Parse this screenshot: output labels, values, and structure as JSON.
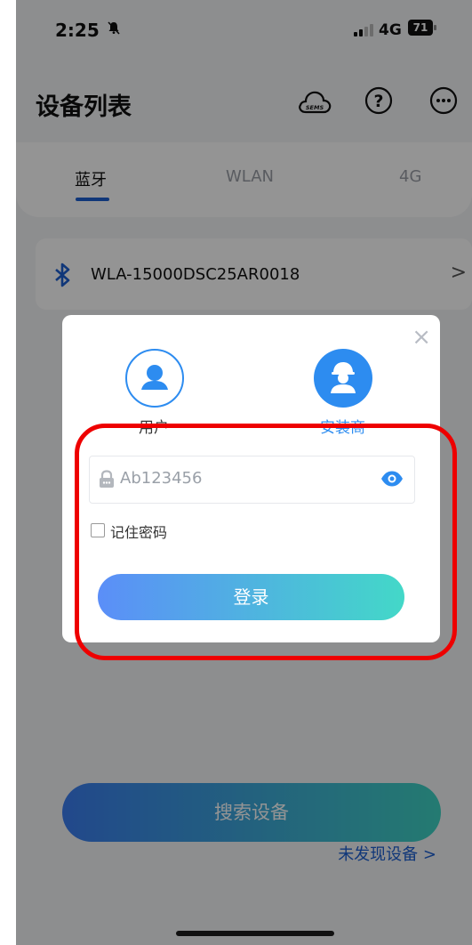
{
  "status_bar": {
    "time": "2:25",
    "network": "4G",
    "battery": "71"
  },
  "header": {
    "title": "设备列表",
    "cloud_badge": "SEMS",
    "help_glyph": "?"
  },
  "tabs": [
    {
      "label": "蓝牙",
      "active": true
    },
    {
      "label": "WLAN",
      "active": false
    },
    {
      "label": "4G",
      "active": false
    }
  ],
  "device": {
    "name": "WLA-15000DSC25AR0018",
    "arrow": ">"
  },
  "search_button": {
    "label": "搜索设备"
  },
  "not_found_link": {
    "label": "未发现设备 >"
  },
  "login_dialog": {
    "close_glyph": "×",
    "roles": [
      {
        "label": "用户",
        "selected": false
      },
      {
        "label": "安装商",
        "selected": true
      }
    ],
    "password": {
      "value": "Ab123456"
    },
    "remember": {
      "label": "记住密码",
      "checked": false
    },
    "login_button": {
      "label": "登录"
    }
  },
  "colors": {
    "accent": "#2d8cf0",
    "link": "#1d5fd0",
    "highlight": "#ee0000"
  }
}
